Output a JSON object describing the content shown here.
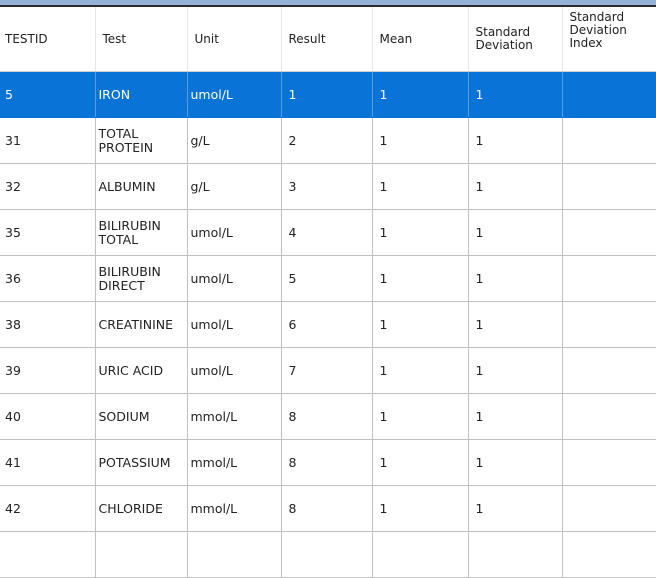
{
  "grid": {
    "columns": [
      "TESTID",
      "Test",
      "Unit",
      "Result",
      "Mean",
      "Standard Deviation",
      "Standard Deviation Index"
    ],
    "selected_row_index": 0,
    "selected_color": "#0a74d6",
    "rows": [
      {
        "testid": "5",
        "test": "IRON",
        "unit": "umol/L",
        "result": "1",
        "mean": "1",
        "sd": "1",
        "sdi": ""
      },
      {
        "testid": "31",
        "test": "TOTAL PROTEIN",
        "unit": "g/L",
        "result": "2",
        "mean": "1",
        "sd": "1",
        "sdi": ""
      },
      {
        "testid": "32",
        "test": "ALBUMIN",
        "unit": "g/L",
        "result": "3",
        "mean": "1",
        "sd": "1",
        "sdi": ""
      },
      {
        "testid": "35",
        "test": "BILIRUBIN TOTAL",
        "unit": "umol/L",
        "result": "4",
        "mean": "1",
        "sd": "1",
        "sdi": ""
      },
      {
        "testid": "36",
        "test": "BILIRUBIN DIRECT",
        "unit": "umol/L",
        "result": "5",
        "mean": "1",
        "sd": "1",
        "sdi": ""
      },
      {
        "testid": "38",
        "test": "CREATININE",
        "unit": "umol/L",
        "result": "6",
        "mean": "1",
        "sd": "1",
        "sdi": ""
      },
      {
        "testid": "39",
        "test": "URIC ACID",
        "unit": "umol/L",
        "result": "7",
        "mean": "1",
        "sd": "1",
        "sdi": ""
      },
      {
        "testid": "40",
        "test": "SODIUM",
        "unit": "mmol/L",
        "result": "8",
        "mean": "1",
        "sd": "1",
        "sdi": ""
      },
      {
        "testid": "41",
        "test": "POTASSIUM",
        "unit": "mmol/L",
        "result": "8",
        "mean": "1",
        "sd": "1",
        "sdi": ""
      },
      {
        "testid": "42",
        "test": "CHLORIDE",
        "unit": "mmol/L",
        "result": "8",
        "mean": "1",
        "sd": "1",
        "sdi": ""
      },
      {
        "testid": "",
        "test": "",
        "unit": "",
        "result": "",
        "mean": "",
        "sd": "",
        "sdi": ""
      }
    ]
  }
}
